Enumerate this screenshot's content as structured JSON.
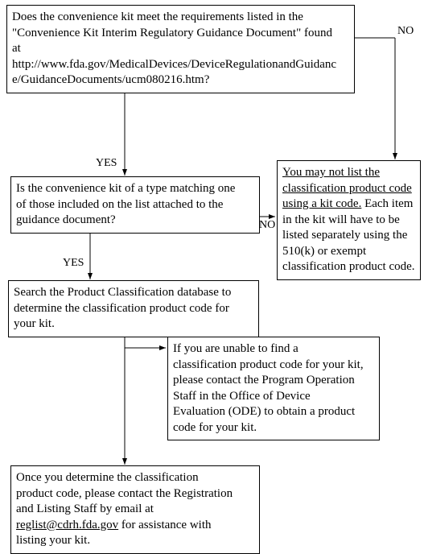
{
  "labels": {
    "yes": "YES",
    "no": "NO"
  },
  "box1": {
    "l1": "Does the convenience kit meet the requirements listed in the",
    "l2": "\"Convenience Kit Interim Regulatory Guidance Document\" found",
    "l3": "at",
    "l4": "http://www.fda.gov/MedicalDevices/DeviceRegulationandGuidanc",
    "l5": "e/GuidanceDocuments/ucm080216.htm?"
  },
  "box2": {
    "l1": "Is the convenience kit of a type matching one",
    "l2": "of those included on the list attached to the",
    "l3": "guidance document?"
  },
  "box3": {
    "u1": "You may not list the",
    "u2": "classification product code",
    "u3": "using a kit code.",
    "r1": "  Each item",
    "l4": "in the kit will have to be",
    "l5": "listed separately using the",
    "l6": "510(k) or exempt",
    "l7": "classification product code."
  },
  "box4": {
    "l1": "Search the Product Classification database to",
    "l2": "determine the classification product code for",
    "l3": "your kit."
  },
  "box5": {
    "l1": "If you are unable to find a",
    "l2": "classification product code for your kit,",
    "l3": "please contact the Program Operation",
    "l4": "Staff in the Office of Device",
    "l5": "Evaluation (ODE) to obtain a product",
    "l6": "code for your kit."
  },
  "box6": {
    "l1": "Once you determine the classification",
    "l2": "product code, please contact the Registration",
    "l3": "and Listing Staff by email at ",
    "u1": "reglist@cdrh.fda.gov",
    "r1": " for assistance with",
    "l5": "listing your kit."
  }
}
